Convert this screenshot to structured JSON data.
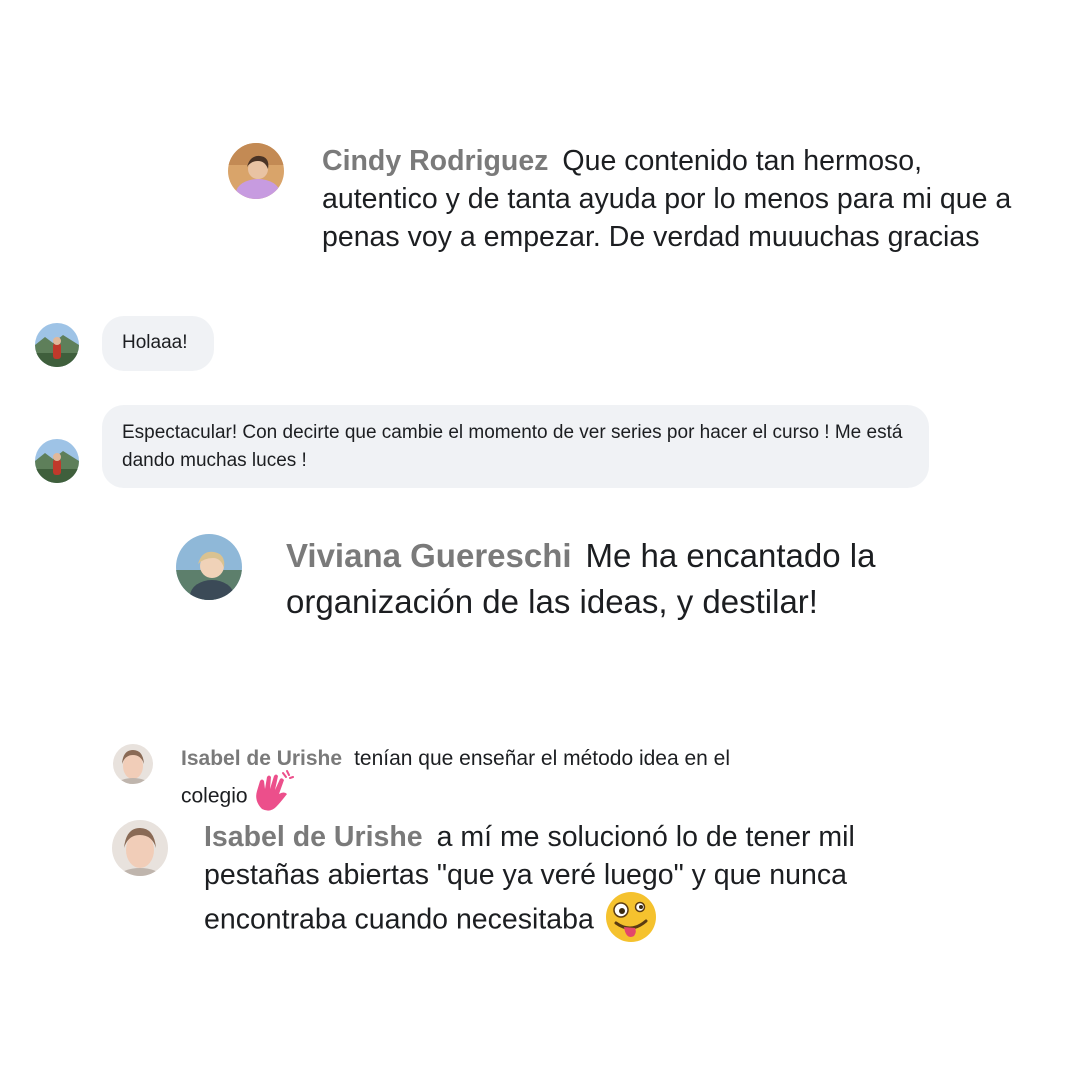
{
  "comments": [
    {
      "author": "Cindy Rodriguez",
      "text": "Que contenido tan hermoso, autentico y de tanta ayuda por lo menos para mi que a penas voy a empezar. De verdad muuuchas gracias",
      "avatar": "woman-pink-shirt-avatar"
    },
    {
      "author": "",
      "text": "Holaaa!",
      "avatar": "landscape-avatar"
    },
    {
      "author": "",
      "text": "Espectacular! Con decirte que cambie el momento de ver series por hacer el curso ! Me está dando muchas luces !",
      "avatar": "landscape-avatar"
    },
    {
      "author": "Viviana Guereschi",
      "text": "Me ha encantado la organización de las ideas, y destilar!",
      "avatar": "woman-outdoor-avatar"
    },
    {
      "author": "Isabel de Urishe",
      "text": "tenían que enseñar el método idea en el colegio",
      "emoji": "waving-hand-emoji",
      "avatar": "woman-portrait-avatar"
    },
    {
      "author": "Isabel de Urishe",
      "text": "a mí me solucionó lo de tener mil pestañas abiertas \"que ya veré luego\" y que nunca encontraba cuando necesitaba",
      "emoji": "zany-face-emoji",
      "avatar": "woman-portrait-avatar"
    }
  ],
  "colors": {
    "author": "#7a7a7a",
    "text": "#1c1e21",
    "bubble": "#f0f2f5",
    "wave_emoji": "#ec4f8b",
    "zany_emoji": "#f5c22e"
  }
}
